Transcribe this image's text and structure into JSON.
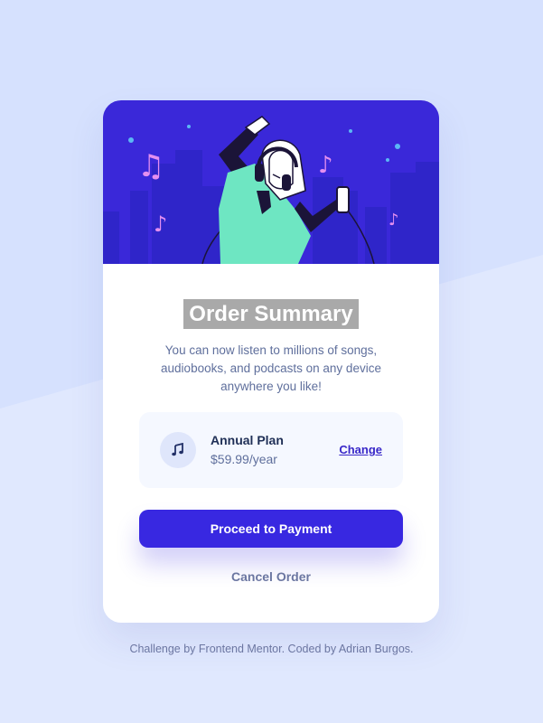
{
  "card": {
    "title": "Order Summary",
    "description": "You can now listen to millions of songs, audiobooks, and podcasts on any device anywhere you like!",
    "hero_icon": "music-illustration"
  },
  "plan": {
    "icon": "music-note-icon",
    "name": "Annual Plan",
    "price": "$59.99/year",
    "change_label": "Change"
  },
  "actions": {
    "proceed_label": "Proceed to Payment",
    "cancel_label": "Cancel Order"
  },
  "footer": {
    "text": "Challenge by Frontend Mentor. Coded by Adrian Burgos."
  },
  "colors": {
    "hero": "#3a28d9",
    "primary": "#3828e1",
    "title_highlight": "#a9a9a9",
    "background": "#e0e8fe"
  }
}
